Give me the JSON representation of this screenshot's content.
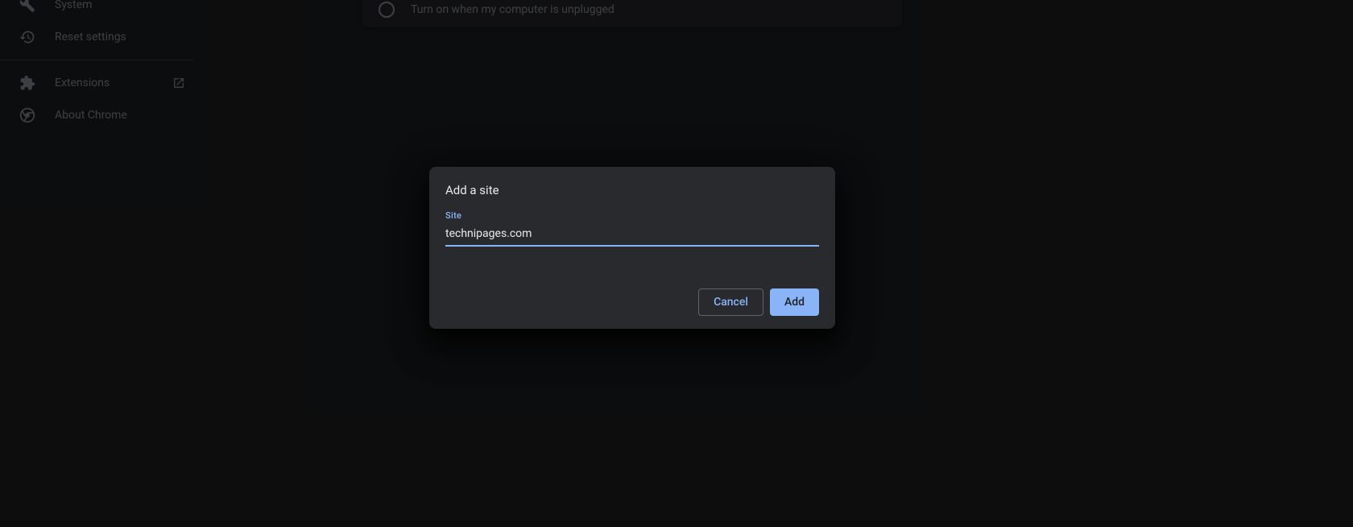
{
  "sidebar": {
    "items": [
      {
        "label": "System"
      },
      {
        "label": "Reset settings"
      },
      {
        "label": "Extensions"
      },
      {
        "label": "About Chrome"
      }
    ]
  },
  "content": {
    "radio_label": "Turn on when my computer is unplugged"
  },
  "modal": {
    "title": "Add a site",
    "input_label": "Site",
    "input_value": "technipages.com",
    "cancel_label": "Cancel",
    "add_label": "Add"
  }
}
